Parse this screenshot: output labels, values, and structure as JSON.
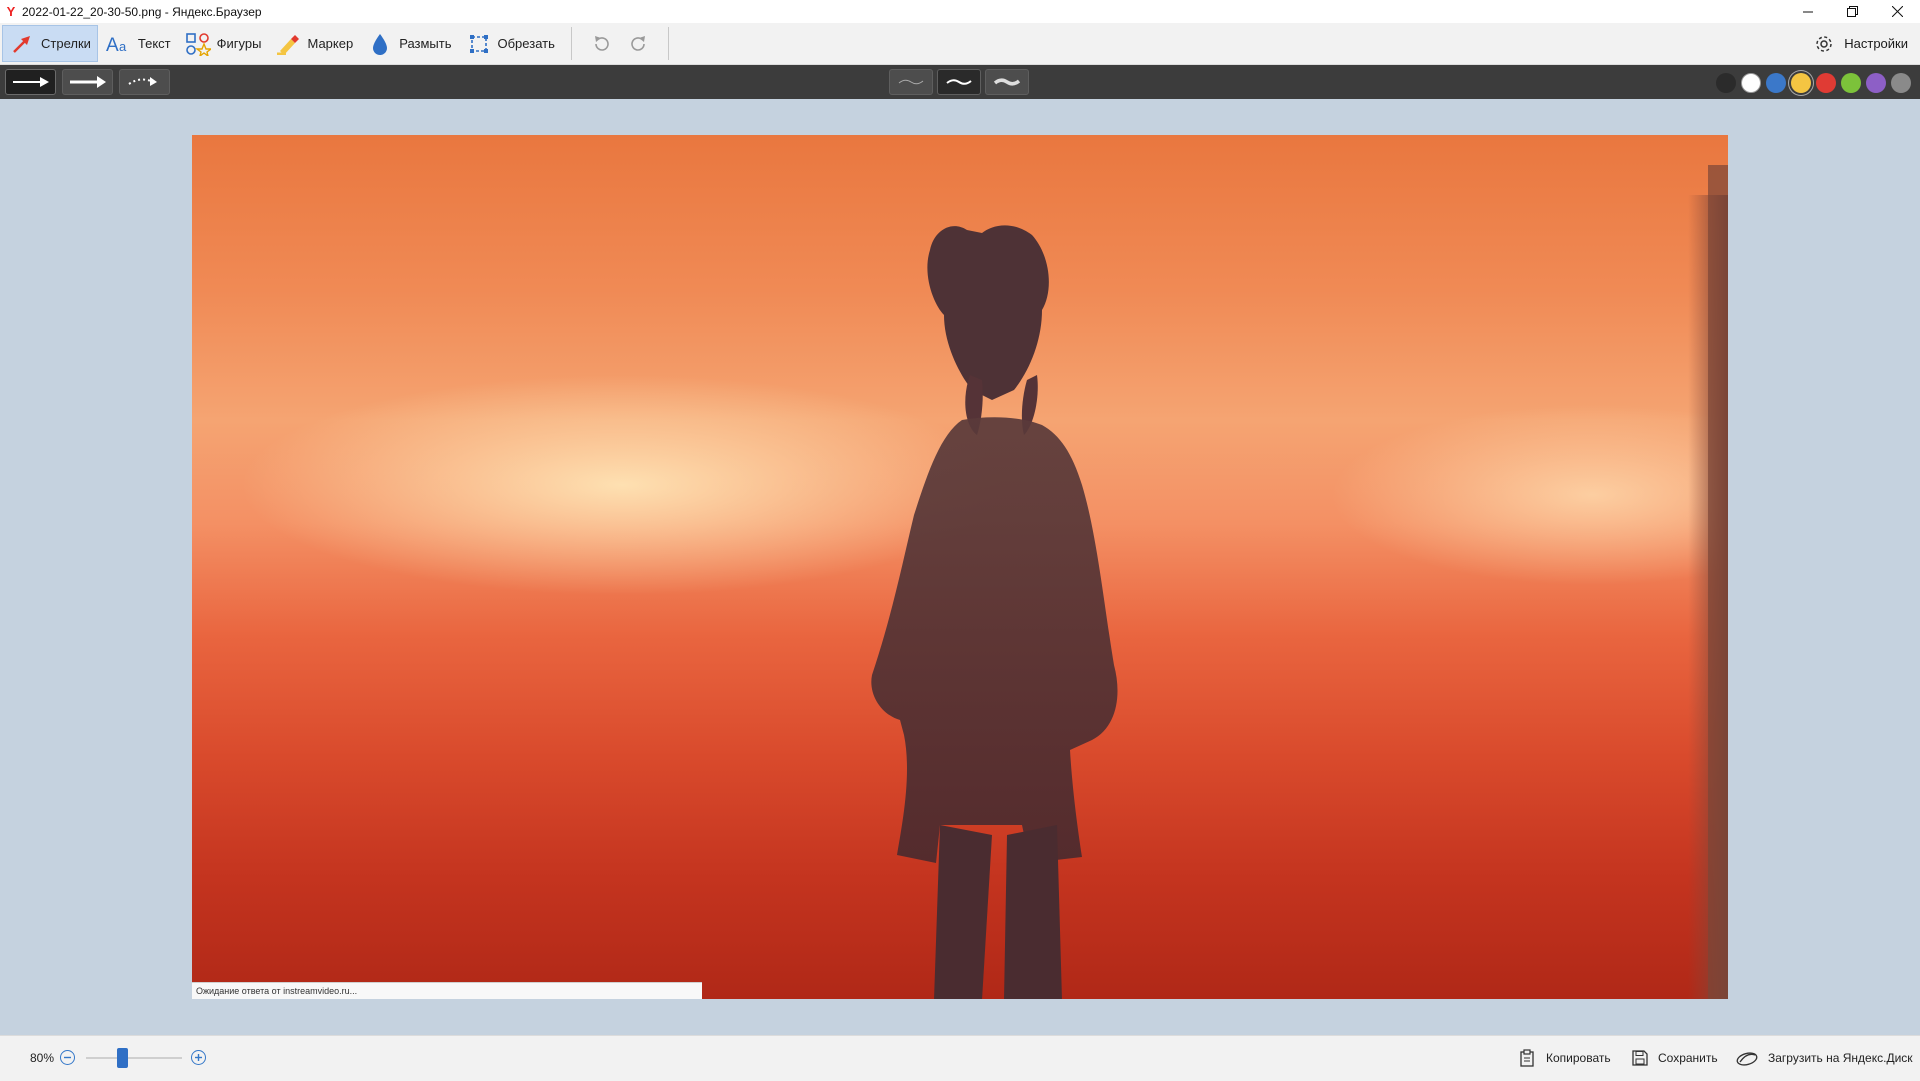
{
  "window": {
    "title": "2022-01-22_20-30-50.png - Яндекс.Браузер",
    "logo_char": "Y"
  },
  "toolbar": {
    "tools": [
      {
        "label": "Стрелки",
        "icon": "arrow-icon",
        "active": true
      },
      {
        "label": "Текст",
        "icon": "text-icon",
        "active": false
      },
      {
        "label": "Фигуры",
        "icon": "shapes-icon",
        "active": false
      },
      {
        "label": "Маркер",
        "icon": "marker-icon",
        "active": false
      },
      {
        "label": "Размыть",
        "icon": "blur-drop-icon",
        "active": false
      },
      {
        "label": "Обрезать",
        "icon": "crop-icon",
        "active": false
      }
    ],
    "settings_label": "Настройки"
  },
  "subbar": {
    "arrow_styles": [
      "solid-arrow",
      "bold-arrow",
      "dotted-curved-arrow"
    ],
    "curve_styles": [
      "thin-curve",
      "medium-curve",
      "thick-curve"
    ],
    "colors": [
      {
        "name": "black",
        "hex": "#2b2b2b"
      },
      {
        "name": "white",
        "hex": "#ffffff"
      },
      {
        "name": "blue",
        "hex": "#3b78c9"
      },
      {
        "name": "yellow",
        "hex": "#f4c542"
      },
      {
        "name": "red",
        "hex": "#e03b34"
      },
      {
        "name": "green",
        "hex": "#7cc23a"
      },
      {
        "name": "purple",
        "hex": "#8d5fc6"
      },
      {
        "name": "gray",
        "hex": "#8a8a8a"
      }
    ],
    "selected_color": "yellow"
  },
  "canvas": {
    "status_text": "Ожидание ответа от instreamvideo.ru..."
  },
  "bottombar": {
    "zoom": "80%",
    "copy_label": "Копировать",
    "save_label": "Сохранить",
    "upload_label": "Загрузить на Яндекс.Диск"
  }
}
